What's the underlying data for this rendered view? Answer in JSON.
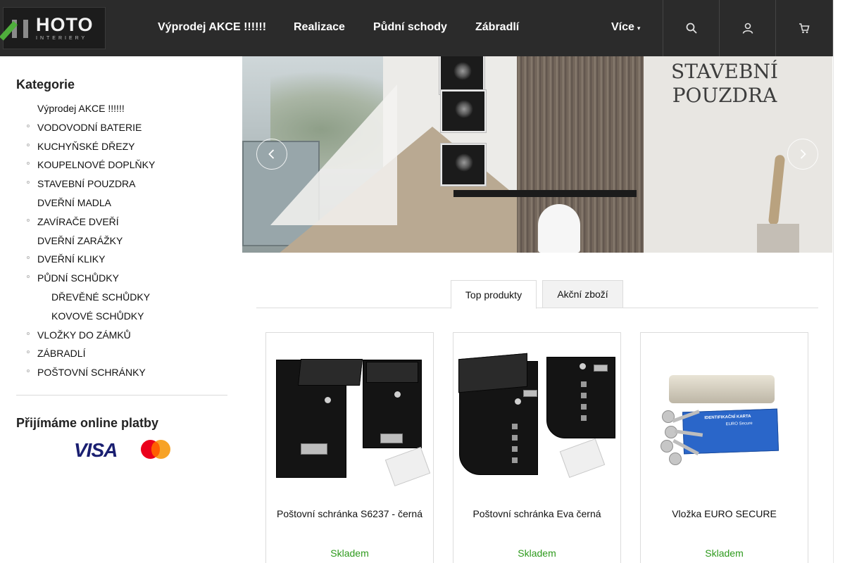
{
  "header": {
    "logo_text": "HOTO",
    "logo_subtext": "INTERIERY",
    "nav": [
      {
        "label": "Výprodej AKCE !!!!!!"
      },
      {
        "label": "Realizace"
      },
      {
        "label": "Půdní schody"
      },
      {
        "label": "Zábradlí"
      },
      {
        "label": "Více"
      }
    ],
    "icons": [
      "search-icon",
      "user-icon",
      "cart-icon"
    ]
  },
  "sidebar": {
    "categories_title": "Kategorie",
    "categories": [
      {
        "label": "Výprodej AKCE !!!!!!",
        "bullet": false,
        "sub": false
      },
      {
        "label": "VODOVODNÍ BATERIE",
        "bullet": true,
        "sub": false
      },
      {
        "label": "KUCHYŇSKÉ DŘEZY",
        "bullet": true,
        "sub": false
      },
      {
        "label": "KOUPELNOVÉ DOPLŇKY",
        "bullet": true,
        "sub": false
      },
      {
        "label": "STAVEBNÍ POUZDRA",
        "bullet": true,
        "sub": false
      },
      {
        "label": "DVEŘNÍ MADLA",
        "bullet": false,
        "sub": false
      },
      {
        "label": "ZAVÍRAČE DVEŘÍ",
        "bullet": true,
        "sub": false
      },
      {
        "label": "DVEŘNÍ ZARÁŽKY",
        "bullet": false,
        "sub": false
      },
      {
        "label": "DVEŘNÍ KLIKY",
        "bullet": true,
        "sub": false
      },
      {
        "label": "PŮDNÍ SCHŮDKY",
        "bullet": true,
        "sub": false
      },
      {
        "label": "DŘEVĚNÉ SCHŮDKY",
        "bullet": false,
        "sub": true
      },
      {
        "label": "KOVOVÉ SCHŮDKY",
        "bullet": false,
        "sub": true
      },
      {
        "label": "VLOŽKY DO ZÁMKŮ",
        "bullet": true,
        "sub": false
      },
      {
        "label": "ZÁBRADLÍ",
        "bullet": true,
        "sub": false
      },
      {
        "label": "POŠTOVNÍ SCHRÁNKY",
        "bullet": true,
        "sub": false
      }
    ],
    "payments_title": "Přijímáme online platby",
    "payment_logos": {
      "visa": "VISA",
      "mastercard": "mastercard-logo"
    }
  },
  "banner": {
    "title_line1": "STAVEBNÍ",
    "title_line2": "POUZDRA"
  },
  "tabs": [
    {
      "label": "Top produkty",
      "active": true
    },
    {
      "label": "Akční zboží",
      "active": false
    }
  ],
  "products": [
    {
      "name": "Poštovní schránka S6237 - černá",
      "stock": "Skladem"
    },
    {
      "name": "Poštovní schránka Eva černá",
      "stock": "Skladem"
    },
    {
      "name": "Vložka EURO SECURE",
      "stock": "Skladem"
    }
  ],
  "product_card_text": {
    "card_label": "IDENTIFIKAČNÍ KARTA",
    "card_brand": "EURO Secure"
  },
  "colors": {
    "header_bg": "#2b2b2b",
    "stock_green": "#2e9a1d",
    "logo_green": "#4fae3c"
  }
}
